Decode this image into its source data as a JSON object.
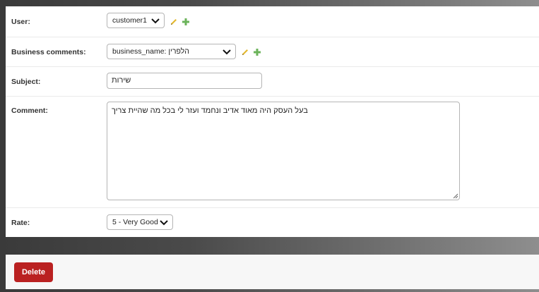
{
  "form": {
    "user": {
      "label": "User:",
      "value": "customer1"
    },
    "business_comments": {
      "label": "Business comments:",
      "value": "business_name: הלפרין"
    },
    "subject": {
      "label": "Subject:",
      "value": "שירות"
    },
    "comment": {
      "label": "Comment:",
      "value": "בעל העסק היה מאוד אדיב ונחמד ועזר לי בכל מה שהיית צריך"
    },
    "rate": {
      "label": "Rate:",
      "value": "5 - Very Good"
    }
  },
  "actions": {
    "delete_label": "Delete"
  },
  "colors": {
    "delete": "#ba2121",
    "edit_icon": "#e3b82e",
    "add_icon": "#6bb35a"
  },
  "icons": [
    "chevron-down-icon",
    "pencil-icon",
    "plus-icon",
    "resize-grip-icon"
  ]
}
